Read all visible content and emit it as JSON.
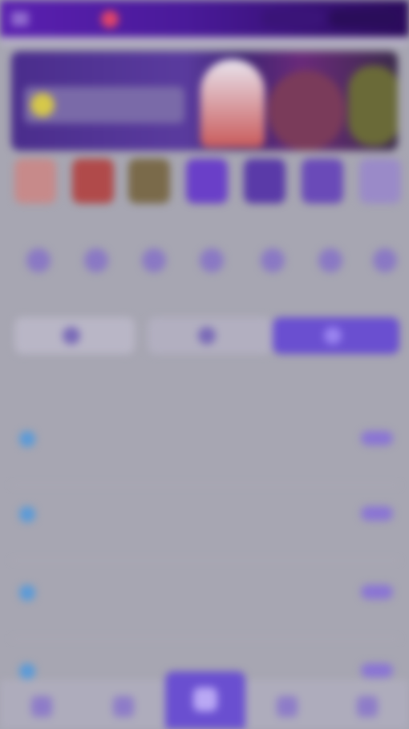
{
  "header": {
    "logo_text": "",
    "login_label": "",
    "register_label": ""
  },
  "banner": {
    "headline": ""
  },
  "games": [
    {
      "name": "",
      "color": "#c78a8a"
    },
    {
      "name": "",
      "color": "#b04a4a"
    },
    {
      "name": "",
      "color": "#7a6a4a"
    },
    {
      "name": "",
      "color": "#6a3fc8"
    },
    {
      "name": "",
      "color": "#5a3aa8"
    },
    {
      "name": "",
      "color": "#6a4ab8"
    },
    {
      "name": "",
      "color": "#9a8ac8"
    }
  ],
  "quick_actions": [
    {
      "label": ""
    },
    {
      "label": ""
    },
    {
      "label": ""
    },
    {
      "label": ""
    },
    {
      "label": ""
    },
    {
      "label": ""
    },
    {
      "label": ""
    }
  ],
  "tabs": [
    {
      "label": ""
    },
    {
      "label": ""
    },
    {
      "label": ""
    }
  ],
  "subtabs": [
    "",
    "",
    "",
    ""
  ],
  "section_title": "",
  "list": [
    {
      "title": "",
      "subtitle": "",
      "meta": ""
    },
    {
      "title": "",
      "subtitle": "",
      "meta": ""
    },
    {
      "title": "",
      "subtitle": "",
      "meta": ""
    },
    {
      "title": "",
      "subtitle": "",
      "meta": ""
    }
  ],
  "bottom_nav": [
    {
      "label": ""
    },
    {
      "label": ""
    },
    {
      "label": "",
      "active": true
    },
    {
      "label": ""
    },
    {
      "label": ""
    }
  ],
  "colors": {
    "brand": "#5a1fb0",
    "accent": "#6a4fd0",
    "overlay_bg": "#a7a6b2"
  }
}
